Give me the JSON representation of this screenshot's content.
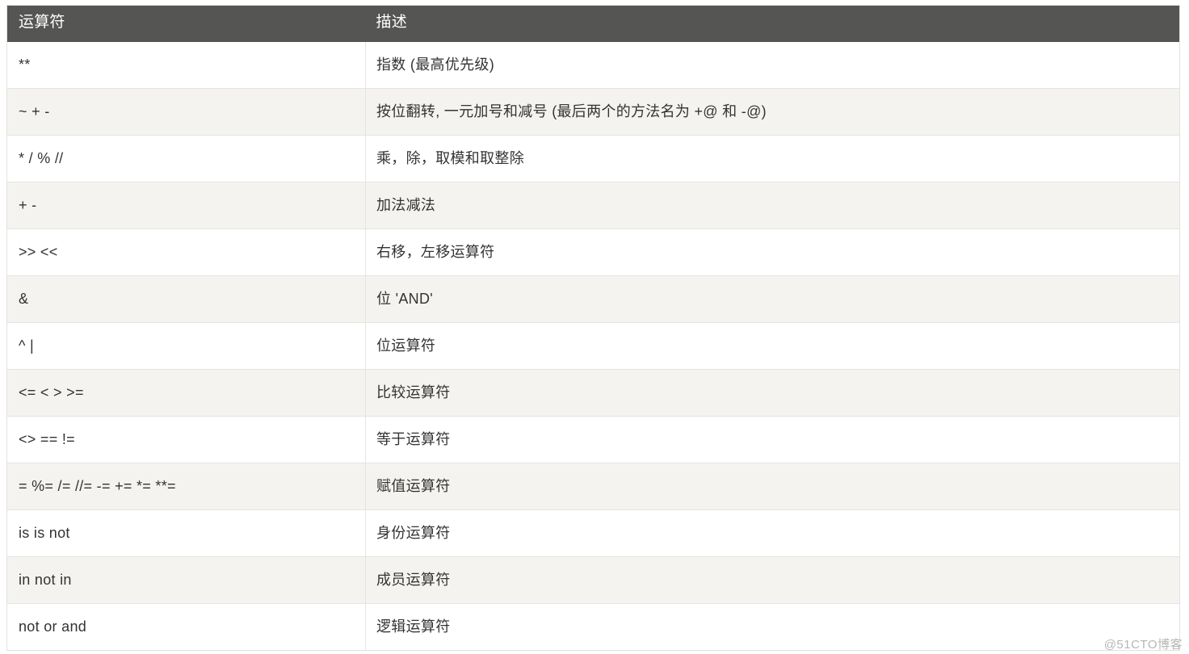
{
  "watermark": "@51CTO博客",
  "table": {
    "columns": [
      "运算符",
      "描述"
    ],
    "rows": [
      {
        "operator": "**",
        "description": "指数 (最高优先级)"
      },
      {
        "operator": "~ + -",
        "description": "按位翻转, 一元加号和减号 (最后两个的方法名为 +@ 和 -@)"
      },
      {
        "operator": "* / % //",
        "description": "乘，除，取模和取整除"
      },
      {
        "operator": "+ -",
        "description": "加法减法"
      },
      {
        "operator": ">> <<",
        "description": "右移，左移运算符"
      },
      {
        "operator": "&",
        "description": "位 'AND'"
      },
      {
        "operator": "^ |",
        "description": "位运算符"
      },
      {
        "operator": "<= < > >=",
        "description": "比较运算符"
      },
      {
        "operator": "<> == !=",
        "description": "等于运算符"
      },
      {
        "operator": "= %= /= //= -= += *= **=",
        "description": "赋值运算符"
      },
      {
        "operator": "is is not",
        "description": "身份运算符"
      },
      {
        "operator": "in not in",
        "description": "成员运算符"
      },
      {
        "operator": "not or and",
        "description": "逻辑运算符"
      }
    ]
  },
  "colors": {
    "header_bg": "#555554",
    "header_text": "#ffffff",
    "row_odd_bg": "#ffffff",
    "row_even_bg": "#f4f3ef",
    "border": "#e4e4e1",
    "body_text": "#333333",
    "watermark_text": "#b6b6b2"
  }
}
